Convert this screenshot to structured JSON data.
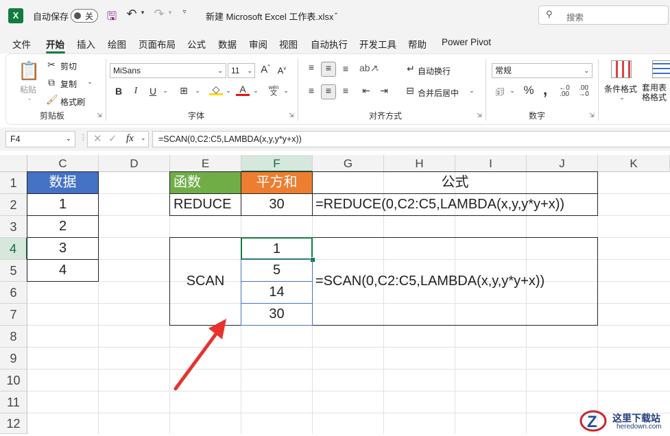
{
  "titlebar": {
    "app_icon": "X",
    "autosave_label": "自动保存",
    "autosave_state": "关",
    "filename": "新建 Microsoft Excel 工作表.xlsx",
    "search_placeholder": "搜索"
  },
  "menu": [
    "文件",
    "开始",
    "插入",
    "绘图",
    "页面布局",
    "公式",
    "数据",
    "审阅",
    "视图",
    "自动执行",
    "开发工具",
    "帮助",
    "Power Pivot"
  ],
  "ribbon": {
    "clipboard": {
      "paste": "粘贴",
      "cut": "剪切",
      "copy": "复制",
      "format_painter": "格式刷",
      "label": "剪贴板"
    },
    "font": {
      "name": "MiSans",
      "size": "11",
      "label": "字体",
      "wen": "wén",
      "wen2": "文"
    },
    "alignment": {
      "wrap": "自动换行",
      "merge": "合并后居中",
      "label": "对齐方式"
    },
    "number": {
      "format": "常规",
      "label": "数字",
      "percent": "%",
      "comma": ","
    },
    "styles": {
      "conditional": "条件格式",
      "table": "套用表格格式"
    }
  },
  "formula_bar": {
    "name_box": "F4",
    "fx": "fx",
    "formula": "=SCAN(0,C2:C5,LAMBDA(x,y,y*y+x))"
  },
  "columns": [
    "C",
    "D",
    "E",
    "F",
    "G",
    "H",
    "I",
    "J",
    "K"
  ],
  "rows": [
    "1",
    "2",
    "3",
    "4",
    "5",
    "6",
    "7",
    "8",
    "9",
    "10",
    "11",
    "12"
  ],
  "sheet": {
    "data_header": "数据",
    "data_values": [
      "1",
      "2",
      "3",
      "4"
    ],
    "func_header": "函数",
    "sum_header": "平方和",
    "formula_header": "公式",
    "reduce_name": "REDUCE",
    "reduce_value": "30",
    "reduce_formula": "=REDUCE(0,C2:C5,LAMBDA(x,y,y*y+x))",
    "scan_name": "SCAN",
    "scan_values": [
      "1",
      "5",
      "14",
      "30"
    ],
    "scan_formula": "=SCAN(0,C2:C5,LAMBDA(x,y,y*y+x))"
  },
  "watermark": {
    "site_cn": "这里下载站",
    "site_en": "heredown.com"
  },
  "colors": {
    "excel_green": "#107c41",
    "header_blue": "#4472c4",
    "header_green": "#70ad47",
    "header_orange": "#ed7d31",
    "arrow_red": "#e8322e"
  }
}
